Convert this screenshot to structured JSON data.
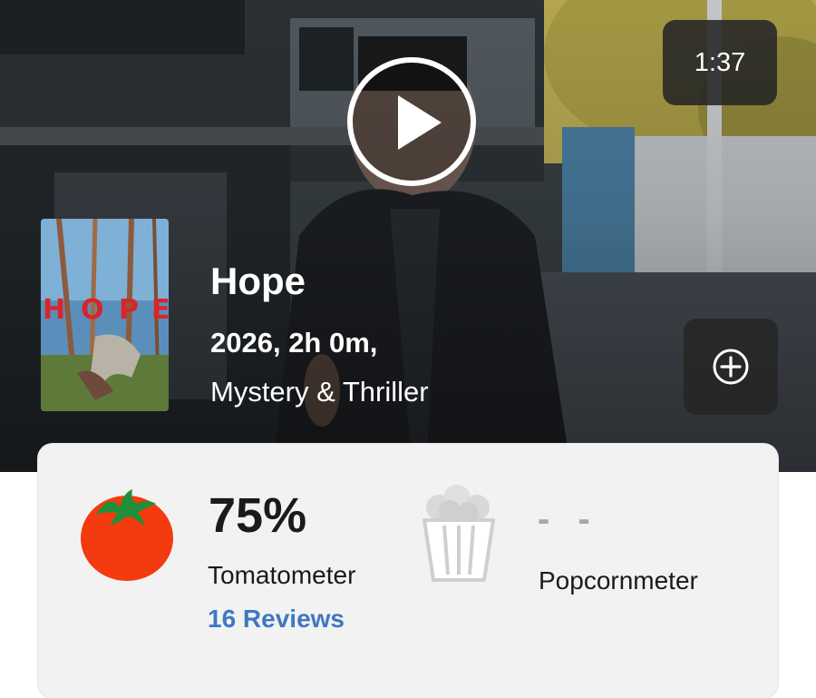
{
  "trailer": {
    "duration": "1:37",
    "play_icon": "play-icon"
  },
  "movie": {
    "title": "Hope",
    "meta": "2026, 2h 0m,",
    "genre": "Mystery & Thriller",
    "poster_icon": "movie-poster"
  },
  "actions": {
    "add_icon": "plus-circle-icon"
  },
  "scores": {
    "tomatometer": {
      "value": "75%",
      "label": "Tomatometer",
      "reviews": "16 Reviews",
      "icon": "tomato-icon",
      "color": "#f43a0f"
    },
    "popcornmeter": {
      "value": "- -",
      "label": "Popcornmeter",
      "icon": "popcorn-icon"
    },
    "link_color": "#3f78c2"
  }
}
